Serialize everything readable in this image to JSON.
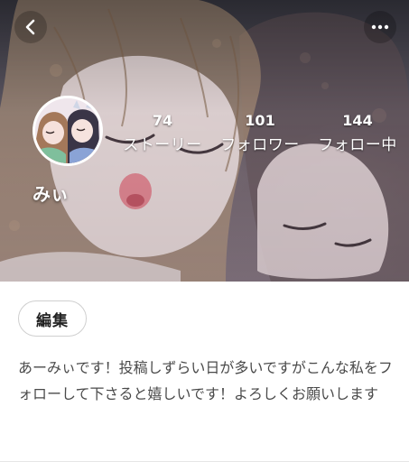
{
  "header": {
    "back_icon": "chevron-left-icon",
    "more_icon": "more-horizontal-icon"
  },
  "profile": {
    "username": "みぃ",
    "avatar": "avatar-illustration-two-anime-girls"
  },
  "stats": [
    {
      "value": "74",
      "label": "ストーリー"
    },
    {
      "value": "101",
      "label": "フォロワー"
    },
    {
      "value": "144",
      "label": "フォロー中"
    }
  ],
  "actions": {
    "edit_label": "編集"
  },
  "bio": "あーみぃです！投稿しずらい日が多いですがこんな私をフォローして下さると嬉しいです！よろしくお願いします",
  "colors": {
    "text_primary": "#222222",
    "text_secondary": "#4a4a4a",
    "overlay_text": "#ffffff",
    "border": "#cfcfcf"
  }
}
